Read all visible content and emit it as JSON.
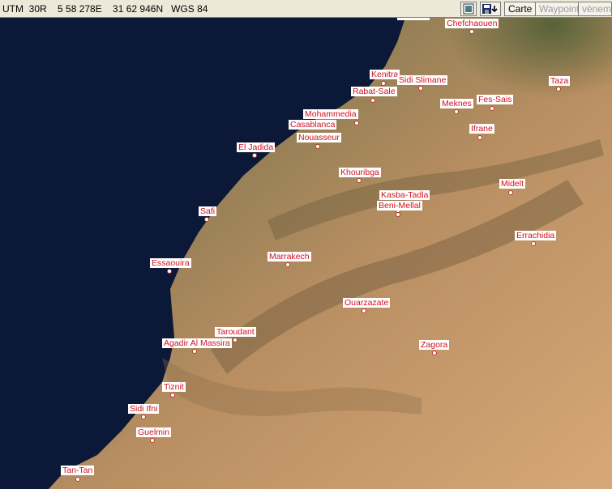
{
  "toolbar": {
    "coordinates": "UTM  30R    5 58 278E    31 62 946N   WGS 84",
    "map_button": "Carte",
    "waypoint_button": "Waypoint",
    "event_button": "vèneme"
  },
  "map": {
    "colors": {
      "ocean": "#0d1a3c",
      "desert": "#c89a6a",
      "label_text": "#d01020"
    },
    "cities": [
      {
        "name": "Chefchaouen"
      },
      {
        "name": "Kenitra"
      },
      {
        "name": "Sidi Slimane"
      },
      {
        "name": "Rabat-Sale"
      },
      {
        "name": "Taza"
      },
      {
        "name": "Meknes"
      },
      {
        "name": "Fes-Sais"
      },
      {
        "name": "Mohammedia"
      },
      {
        "name": "Casablanca"
      },
      {
        "name": "Nouasseur"
      },
      {
        "name": "Ifrane"
      },
      {
        "name": "El Jadida"
      },
      {
        "name": "Khouribga"
      },
      {
        "name": "Midelt"
      },
      {
        "name": "Kasba-Tadla"
      },
      {
        "name": "Beni-Mellal"
      },
      {
        "name": "Safi"
      },
      {
        "name": "Errachidia"
      },
      {
        "name": "Essaouira"
      },
      {
        "name": "Marrakech"
      },
      {
        "name": "Ouarzazate"
      },
      {
        "name": "Taroudant"
      },
      {
        "name": "Agadir Al Massira"
      },
      {
        "name": "Zagora"
      },
      {
        "name": "Tiznit"
      },
      {
        "name": "Sidi Ifni"
      },
      {
        "name": "Guelmin"
      },
      {
        "name": "Tan-Tan"
      }
    ]
  }
}
